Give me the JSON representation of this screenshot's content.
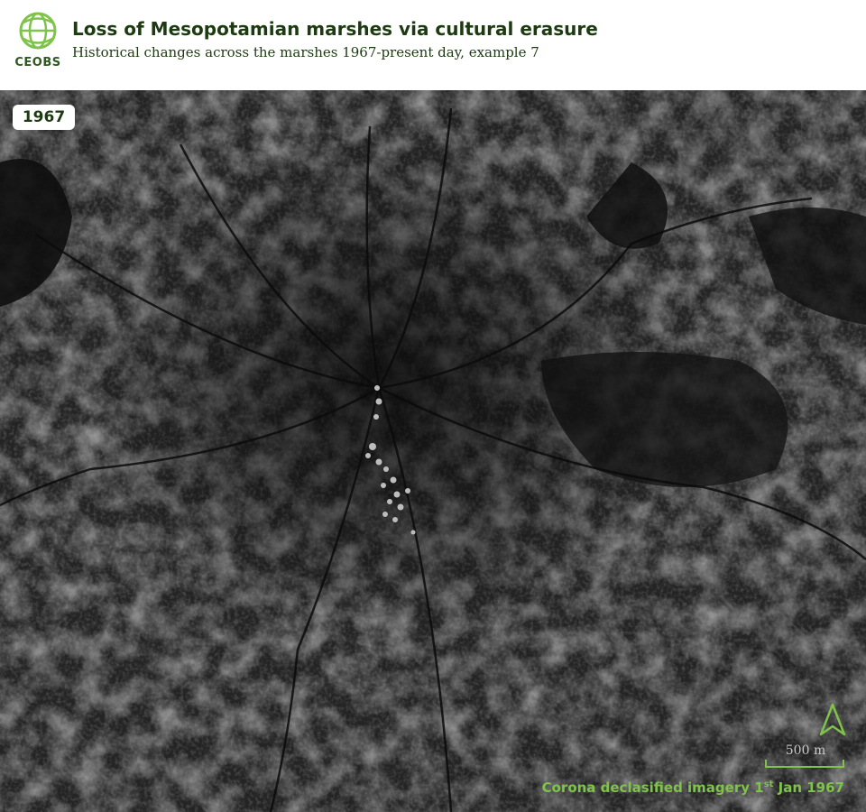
{
  "header": {
    "logo_text": "CEOBS",
    "title": "Loss of Mesopotamian marshes via cultural erasure",
    "subtitle": "Historical changes across the marshes 1967-present day, example 7"
  },
  "map": {
    "year": "1967",
    "scale_label": "500 m",
    "credit": {
      "prefix": "Corona declasified imagery 1",
      "ordinal": "st",
      "suffix": " Jan 1967"
    }
  },
  "colors": {
    "accent_green": "#7fc34a",
    "title_green": "#1d3a12"
  },
  "icons": [
    "ceobs-globe-icon",
    "north-arrow-icon",
    "scale-bar-icon"
  ]
}
